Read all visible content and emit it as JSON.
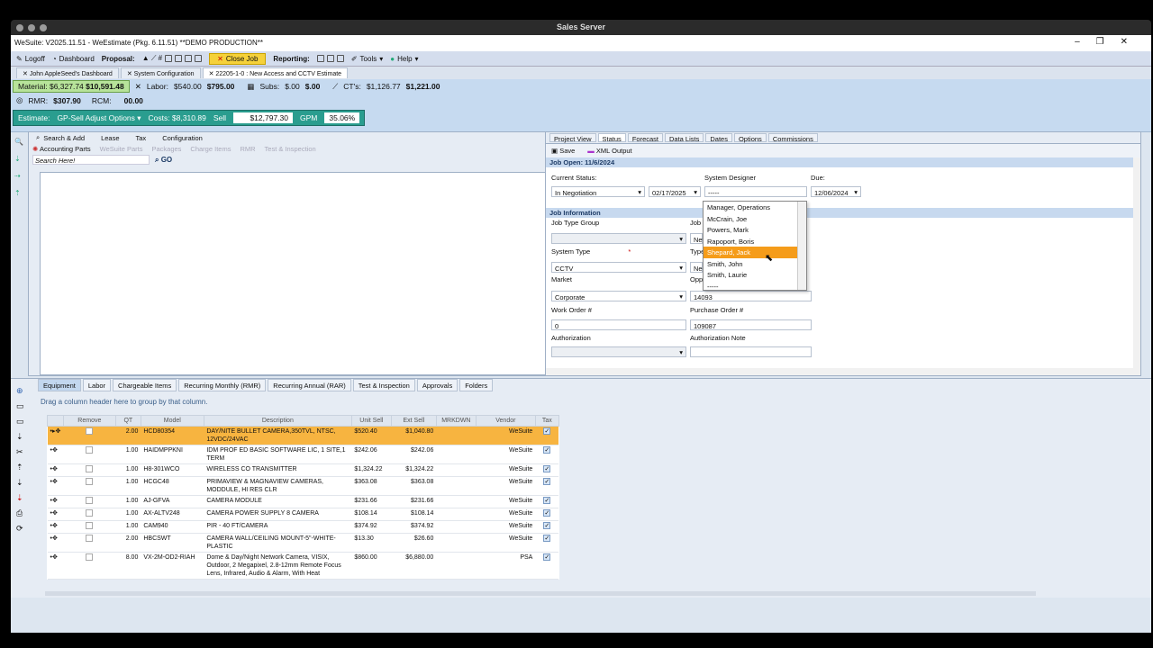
{
  "window_title": "Sales Server",
  "app_title": "WeSuite: V2025.11.51 - WeEstimate (Pkg. 6.11.51) **DEMO PRODUCTION**",
  "menu": {
    "logoff": "Logoff",
    "dashboard": "Dashboard",
    "proposal": "Proposal:",
    "close_job": "Close Job",
    "reporting": "Reporting:",
    "tools": "Tools",
    "help": "Help"
  },
  "doc_tabs": [
    "John AppleSeed's Dashboard",
    "System Configuration",
    "22205-1-0 : New Access and CCTV Estimate"
  ],
  "costs": {
    "material_label": "Material:",
    "material_cost": "$6,327.74",
    "material_sell": "$10,591.48",
    "labor_label": "Labor:",
    "labor_cost": "$540.00",
    "labor_sell": "$795.00",
    "subs_label": "Subs:",
    "subs_cost": "$.00",
    "subs_sell": "$.00",
    "cts_label": "CT's:",
    "cts_cost": "$1,126.77",
    "cts_sell": "$1,221.00",
    "rmr_label": "RMR:",
    "rmr_val": "$307.90",
    "rcm_label": "RCM:",
    "rcm_val": "00.00",
    "estimate_label": "Estimate:",
    "gp_options": "GP-Sell Adjust Options",
    "costs_text": "Costs: $8,310.89",
    "sell_label": "Sell",
    "sell_val": "$12,797.30",
    "gpm_label": "GPM",
    "gpm_val": "35.06%"
  },
  "left_tabs": [
    "Search & Add",
    "Lease",
    "Tax",
    "Configuration"
  ],
  "left_subtabs": [
    "Accounting Parts",
    "WeSuite Parts",
    "Packages",
    "Charge Items",
    "RMR",
    "Test & Inspection"
  ],
  "search_placeholder": "Search Here!",
  "go": "GO",
  "right_tabs": [
    "Project View",
    "Status",
    "Forecast",
    "Data Lists",
    "Dates",
    "Options",
    "Commissions"
  ],
  "save": "Save",
  "xml_output": "XML Output",
  "job_open": "Job Open: 11/6/2024",
  "status": {
    "current_status_label": "Current Status:",
    "current_status": "In Negotiation",
    "status_date": "02/17/2025",
    "designer_label": "System Designer",
    "designer_value": "-----",
    "due_label": "Due:",
    "due": "12/06/2024"
  },
  "job_info": "Job Information",
  "fields": {
    "job_type_group": "Job Type Group",
    "job": "Job",
    "job_val": "New",
    "system_type_label": "System Type",
    "required_mark": "*",
    "system_type": "CCTV",
    "type": "Type",
    "type_val": "Neg",
    "market_label": "Market",
    "market": "Corporate",
    "opp": "Opp",
    "opp_val": "14093",
    "wo_label": "Work Order #",
    "wo": "0",
    "po_label": "Purchase Order #",
    "po": "109087",
    "auth_label": "Authorization",
    "auth_note_label": "Authorization Note"
  },
  "designer_options": [
    "Manager, Operations",
    "McCrain, Joe",
    "Powers, Mark",
    "Rapoport, Boris",
    "Shepard, Jack",
    "Smith, John",
    "Smith, Laurie",
    "-----"
  ],
  "bottom_tabs": [
    "Equipment",
    "Labor",
    "Chargeable Items",
    "Recurring Monthly (RMR)",
    "Recurring Annual (RAR)",
    "Test & Inspection",
    "Approvals",
    "Folders"
  ],
  "drag_tip": "Drag a column header here to group by that column.",
  "columns": [
    "Remove",
    "QT",
    "Model",
    "Description",
    "Unit Sell",
    "Ext Sell",
    "MRKDWN",
    "Vendor",
    "Tax"
  ],
  "rows": [
    {
      "qt": "2.00",
      "model": "HCD80354",
      "desc": "DAY/NITE BULLET CAMERA,350TVL, NTSC, 12VDC/24VAC",
      "unit": "$520.40",
      "ext": "$1,040.80",
      "vendor": "WeSuite"
    },
    {
      "qt": "1.00",
      "model": "HAIDMPPKNI",
      "desc": "IDM PROF ED BASIC SOFTWARE LIC, 1 SITE,1 TERM",
      "unit": "$242.06",
      "ext": "$242.06",
      "vendor": "WeSuite"
    },
    {
      "qt": "1.00",
      "model": "H8-301WCO",
      "desc": "WIRELESS CO TRANSMITTER",
      "unit": "$1,324.22",
      "ext": "$1,324.22",
      "vendor": "WeSuite"
    },
    {
      "qt": "1.00",
      "model": "HCGC48",
      "desc": "PRIMAVIEW & MAGNAVIEW CAMERAS, MODDULE, HI RES CLR",
      "unit": "$363.08",
      "ext": "$363.08",
      "vendor": "WeSuite"
    },
    {
      "qt": "1.00",
      "model": "AJ-GFVA",
      "desc": "CAMERA MODULE",
      "unit": "$231.66",
      "ext": "$231.66",
      "vendor": "WeSuite"
    },
    {
      "qt": "1.00",
      "model": "AX-ALTV248",
      "desc": "CAMERA POWER SUPPLY 8 CAMERA",
      "unit": "$108.14",
      "ext": "$108.14",
      "vendor": "WeSuite"
    },
    {
      "qt": "1.00",
      "model": "CAM940",
      "desc": "PIR - 40 FT/CAMERA",
      "unit": "$374.92",
      "ext": "$374.92",
      "vendor": "WeSuite"
    },
    {
      "qt": "2.00",
      "model": "HBCSWT",
      "desc": "CAMERA WALL/CEILING MOUNT-5\"-WHITE-PLASTIC",
      "unit": "$13.30",
      "ext": "$26.60",
      "vendor": "WeSuite"
    },
    {
      "qt": "8.00",
      "model": "VX-2M-OD2-RIAH",
      "desc": "Dome & Day/Night Network Camera, VISIX, Outdoor, 2 Megapixel, 2.8-12mm Remote Focus Lens, Infrared, Audio & Alarm, With Heat",
      "unit": "$860.00",
      "ext": "$6,880.00",
      "vendor": "PSA"
    }
  ]
}
